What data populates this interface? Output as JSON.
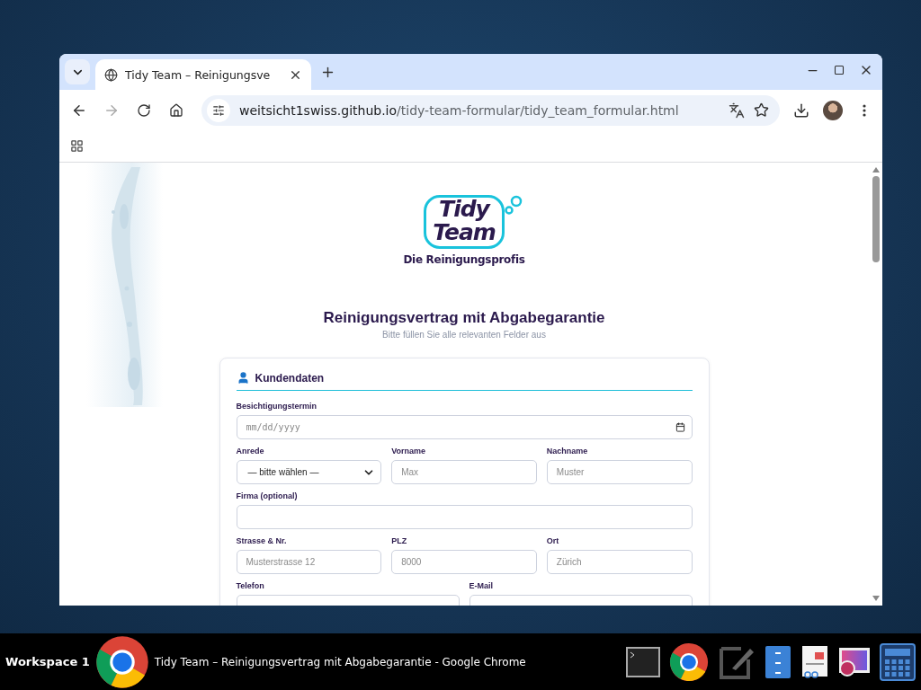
{
  "window": {
    "tab_title": "Tidy Team – Reinigungsve",
    "url_host": "weitsicht1swiss.github.io",
    "url_path": "/tidy-team-formular/tidy_team_formular.html"
  },
  "page": {
    "logo": {
      "line_1": "Tidy",
      "line_2": "Team",
      "tagline": "Die Reinigungsprofis"
    },
    "title": "Reinigungsvertrag mit Abgabegarantie",
    "subtitle": "Bitte füllen Sie alle relevanten Felder aus"
  },
  "form": {
    "section": "Kundendaten",
    "rows": [
      [
        {
          "label": "Besichtigungstermin",
          "kind": "date",
          "placeholder": "mm/dd/yyyy"
        }
      ],
      [
        {
          "label": "Anrede",
          "kind": "select",
          "value": "— bitte wählen —"
        },
        {
          "label": "Vorname",
          "kind": "text",
          "placeholder": "Max"
        },
        {
          "label": "Nachname",
          "kind": "text",
          "placeholder": "Muster"
        }
      ],
      [
        {
          "label": "Firma (optional)",
          "kind": "text"
        }
      ],
      [
        {
          "label": "Strasse & Nr.",
          "kind": "text",
          "placeholder": "Musterstrasse 12"
        },
        {
          "label": "PLZ",
          "kind": "text",
          "placeholder": "8000"
        },
        {
          "label": "Ort",
          "kind": "text",
          "placeholder": "Zürich"
        }
      ],
      [
        {
          "label": "Telefon",
          "kind": "text"
        },
        {
          "label": "E-Mail",
          "kind": "text"
        }
      ]
    ]
  },
  "taskbar": {
    "workspace": "Workspace 1",
    "window_title": "Tidy Team – Reinigungsvertrag mit Abgabegarantie - Google Chrome"
  }
}
